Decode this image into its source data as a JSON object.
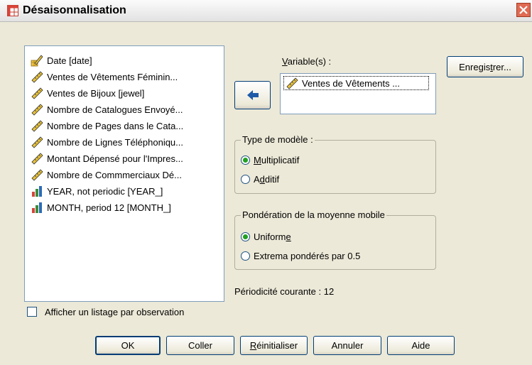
{
  "window": {
    "title": "Désaisonnalisation",
    "icon": "grid-table-icon",
    "close_icon": "close-icon"
  },
  "source_list": {
    "items": [
      {
        "label": "Date [date]",
        "icon": "date-ruler-icon"
      },
      {
        "label": "Ventes de Vêtements Féminin...",
        "icon": "scale-ruler-icon"
      },
      {
        "label": "Ventes de Bijoux [jewel]",
        "icon": "scale-ruler-icon"
      },
      {
        "label": "Nombre de Catalogues Envoyé...",
        "icon": "scale-ruler-icon"
      },
      {
        "label": "Nombre de Pages dans le Cata...",
        "icon": "scale-ruler-icon"
      },
      {
        "label": "Nombre de Lignes Téléphoniqu...",
        "icon": "scale-ruler-icon"
      },
      {
        "label": "Montant Dépensé pour l'Impres...",
        "icon": "scale-ruler-icon"
      },
      {
        "label": "Nombre de Commmerciaux Dé...",
        "icon": "scale-ruler-icon"
      },
      {
        "label": "YEAR, not periodic [YEAR_]",
        "icon": "ordinal-bars-icon"
      },
      {
        "label": "MONTH, period 12 [MONTH_]",
        "icon": "ordinal-bars-icon"
      }
    ]
  },
  "move_button": {
    "icon": "arrow-left-icon"
  },
  "variables": {
    "label_pre": "",
    "label_ul": "V",
    "label_post": "ariable(s) :",
    "items": [
      {
        "label": "Ventes de Vêtements ...",
        "icon": "scale-ruler-icon"
      }
    ]
  },
  "save_button": {
    "pre": "Enregis",
    "ul": "t",
    "post": "rer..."
  },
  "model_type": {
    "title": "Type de modèle :",
    "options": [
      {
        "pre": "",
        "ul": "M",
        "post": "ultiplicatif",
        "selected": true
      },
      {
        "pre": "A",
        "ul": "d",
        "post": "ditif",
        "selected": false
      }
    ]
  },
  "weighting": {
    "title": "Pondération de la moyenne mobile",
    "options": [
      {
        "pre": "Uniform",
        "ul": "e",
        "post": "",
        "selected": true
      },
      {
        "pre": "Extrema pondérés par 0.5",
        "ul": "",
        "post": "",
        "selected": false
      }
    ]
  },
  "periodicity": "Périodicité courante : 12",
  "casewise_checkbox": {
    "label": "Afficher un listage par observation",
    "checked": false
  },
  "buttons": {
    "ok": {
      "pre": "OK",
      "ul": "",
      "post": ""
    },
    "paste": {
      "pre": "Coller",
      "ul": "",
      "post": ""
    },
    "reset": {
      "pre": "",
      "ul": "R",
      "post": "éinitialiser"
    },
    "cancel": {
      "pre": "Annuler",
      "ul": "",
      "post": ""
    },
    "help": {
      "pre": "Aide",
      "ul": "",
      "post": ""
    }
  },
  "colors": {
    "arrow_button": "#1e5aa8",
    "selected_radio": "#21a121",
    "close_button": "#e06a52",
    "focus_border": "#003c74"
  }
}
